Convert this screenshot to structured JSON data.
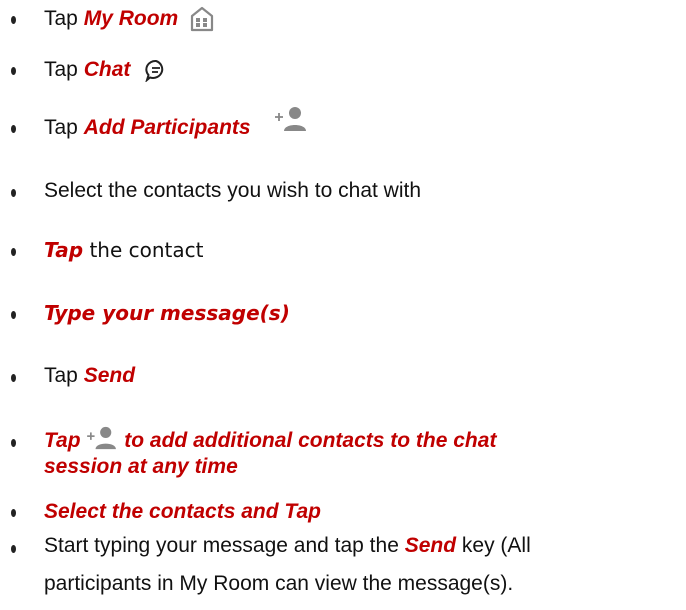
{
  "colors": {
    "accent": "#c00000",
    "text": "#111111",
    "icon": "#888888"
  },
  "steps": [
    {
      "pre": "Tap ",
      "em": "My Room",
      "icon": "my-room-icon"
    },
    {
      "pre": "Tap ",
      "em": "Chat",
      "icon": "chat-bubble-icon"
    },
    {
      "pre": "Tap ",
      "em": "Add Participants",
      "icon": "add-person-icon"
    },
    {
      "text": "Select the contacts you wish to chat with"
    },
    {
      "em": "Tap",
      "post": " the contact"
    },
    {
      "em": "Type your message(s)"
    },
    {
      "pre": "Tap ",
      "em": "Send"
    },
    {
      "em_start": "Tap",
      "icon": "add-person-icon",
      "em_end": "to add additional contacts to the chat",
      "em_line2": "session at any time"
    },
    {
      "em": "Select the contacts and Tap"
    },
    {
      "pre": "Start typing your message and tap the ",
      "em": "Send",
      "post": " key (All",
      "line2": "participants in My Room can view the message(s)."
    }
  ]
}
